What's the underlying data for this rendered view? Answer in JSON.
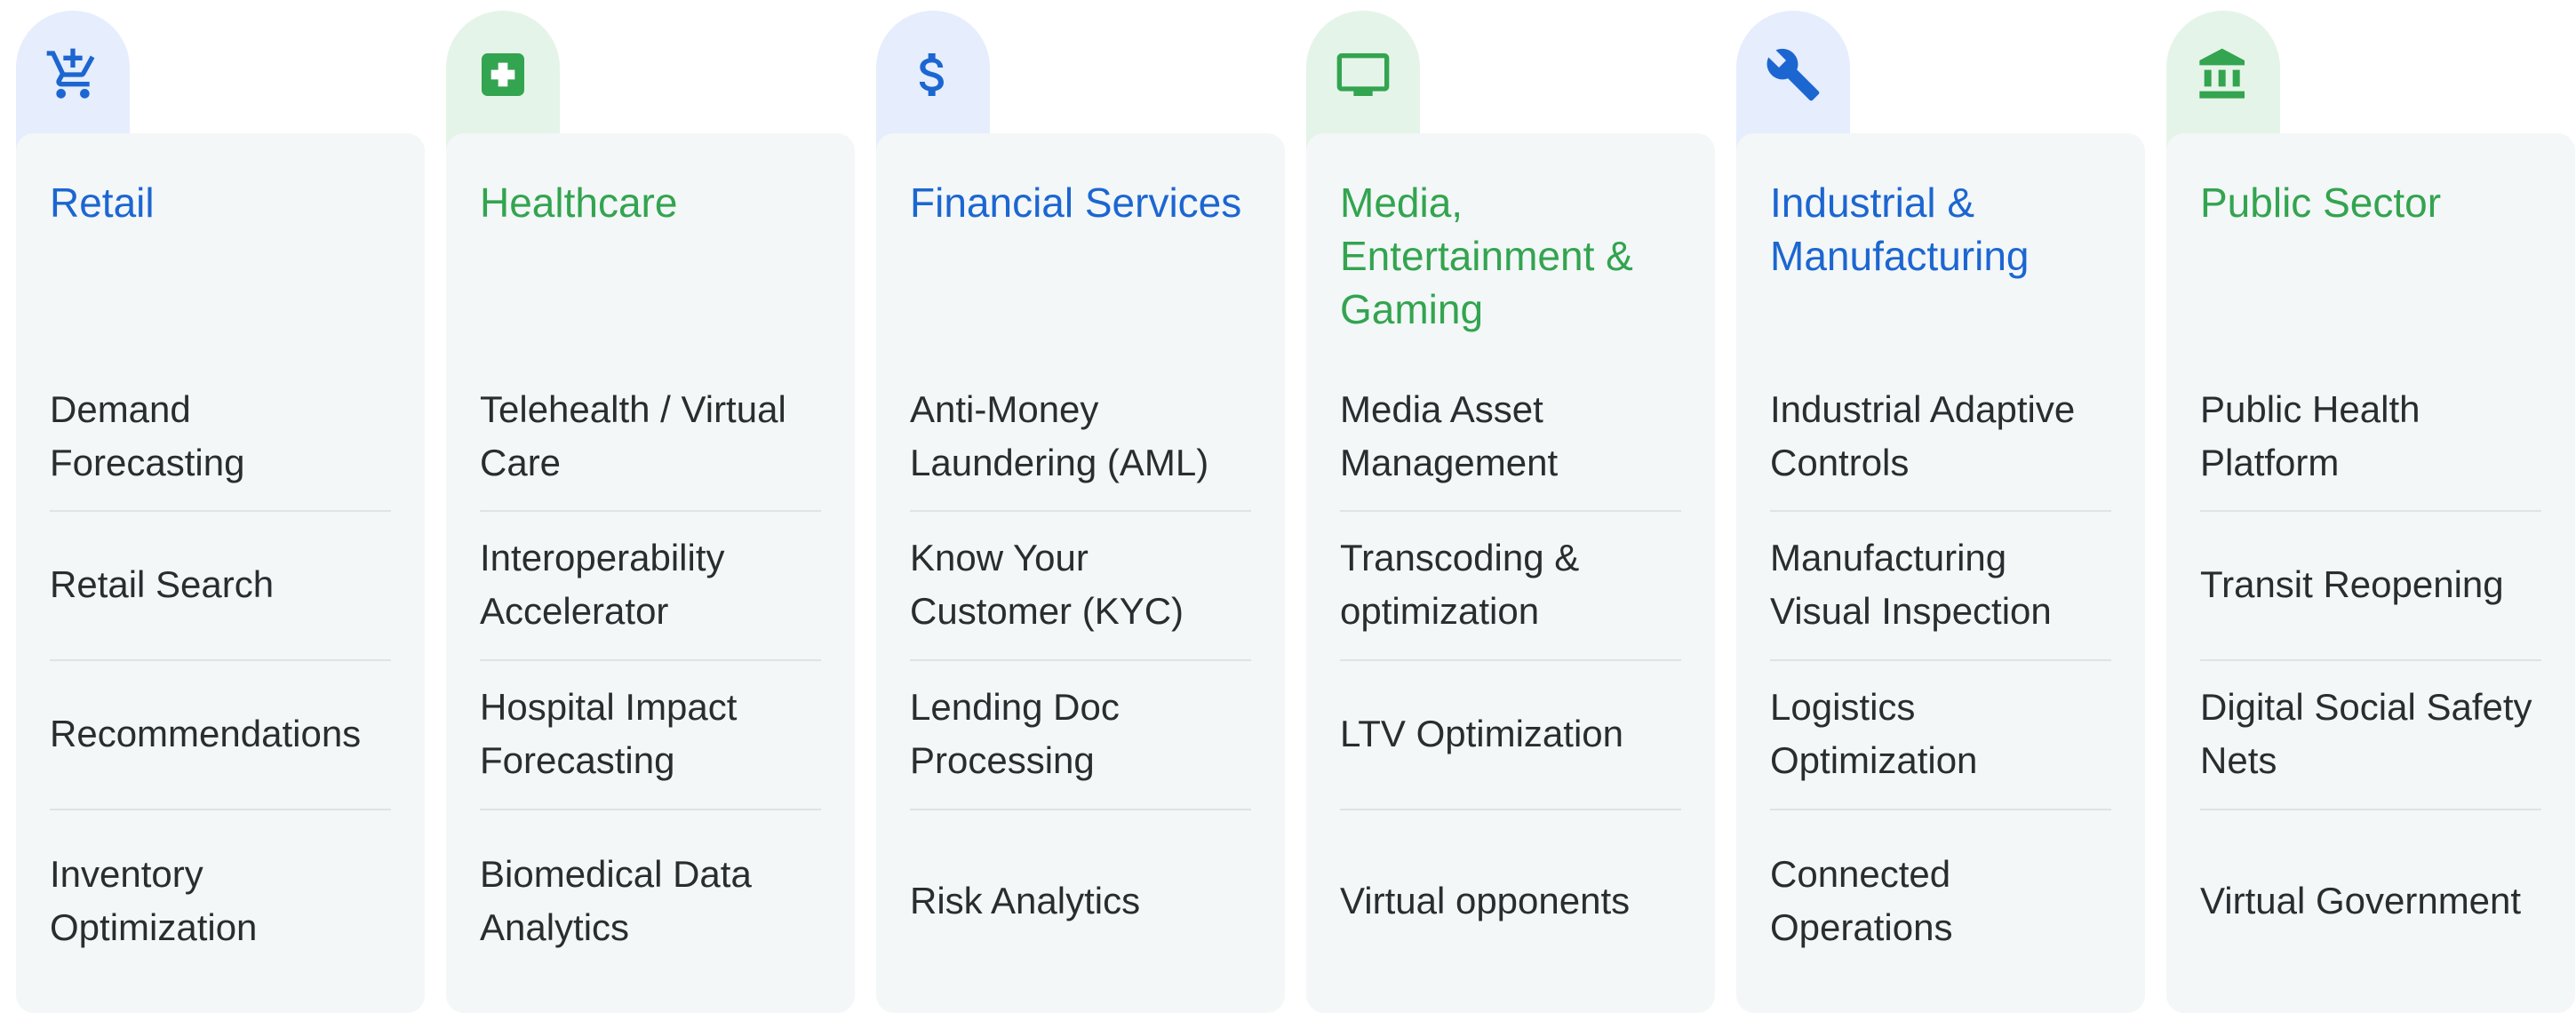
{
  "colors": {
    "blue": "#1c66d1",
    "green": "#33a44f",
    "blue_tab_bg": "#e6edfd",
    "green_tab_bg": "#e5f4e8",
    "card_bg": "#f3f7f8",
    "text": "#2a2d30"
  },
  "columns": [
    {
      "icon": "shopping-cart-add-icon",
      "accent": "blue",
      "title": "Retail",
      "items": [
        "Demand Forecasting",
        "Retail Search",
        "Recommendations",
        "Inventory Optimization"
      ]
    },
    {
      "icon": "medical-cross-icon",
      "accent": "green",
      "title": "Healthcare",
      "items": [
        "Telehealth / Virtual Care",
        "Interoperability Accelerator",
        "Hospital Impact Forecasting",
        "Biomedical Data Analytics"
      ]
    },
    {
      "icon": "dollar-icon",
      "accent": "blue",
      "title": "Financial Services",
      "items": [
        "Anti-Money Laundering (AML)",
        "Know Your Customer (KYC)",
        "Lending Doc Processing",
        "Risk Analytics"
      ]
    },
    {
      "icon": "monitor-icon",
      "accent": "green",
      "title": "Media, Entertainment & Gaming",
      "items": [
        "Media Asset Management",
        "Transcoding & optimization",
        "LTV Optimization",
        "Virtual opponents"
      ]
    },
    {
      "icon": "wrench-icon",
      "accent": "blue",
      "title": "Industrial & Manufacturing",
      "items": [
        "Industrial Adaptive Controls",
        "Manufacturing Visual Inspection",
        "Logistics Optimization",
        "Connected Operations"
      ]
    },
    {
      "icon": "government-building-icon",
      "accent": "green",
      "title": "Public Sector",
      "items": [
        "Public Health Platform",
        "Transit Reopening",
        "Digital Social Safety Nets",
        "Virtual Government"
      ]
    }
  ]
}
